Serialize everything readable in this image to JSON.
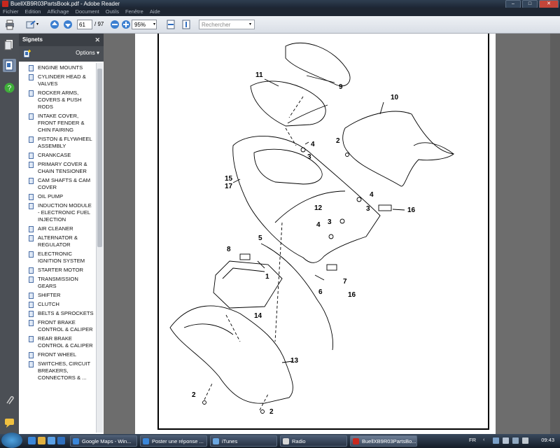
{
  "window": {
    "title": "BuellXB9R03PartsBook.pdf - Adobe Reader",
    "min": "–",
    "max": "□",
    "close": "✕"
  },
  "menu": [
    "Fichier",
    "Edition",
    "Affichage",
    "Document",
    "Outils",
    "Fenêtre",
    "Aide"
  ],
  "toolbar": {
    "page_value": "61",
    "page_total": "/ 97",
    "zoom": "95%",
    "search_placeholder": "Rechercher"
  },
  "bookmarks": {
    "header": "Signets",
    "options_label": "Options",
    "items": [
      "ENGINE MOUNTS",
      "CYLINDER HEAD & VALVES",
      "ROCKER ARMS, COVERS & PUSH RODS",
      "INTAKE COVER, FRONT FENDER & CHIN FAIRING",
      "PISTON & FLYWHEEL ASSEMBLY",
      "CRANKCASE",
      "PRIMARY COVER & CHAIN TENSIONER",
      "CAM SHAFTS & CAM COVER",
      "OIL PUMP",
      "INDUCTION MODULE - ELECTRONIC FUEL INJECTION",
      "AIR CLEANER",
      "ALTERNATOR & REGULATOR",
      "ELECTRONIC IGNITION SYSTEM",
      "STARTER MOTOR",
      "TRANSMISSION GEARS",
      "SHIFTER",
      "CLUTCH",
      "BELTS & SPROCKETS",
      "FRONT BRAKE CONTROL & CALIPER",
      "REAR BRAKE CONTROL & CALIPER",
      "FRONT WHEEL",
      "SWITCHES, CIRCUIT BREAKERS, CONNECTORS & ..."
    ]
  },
  "diagram": {
    "callouts": [
      "9",
      "11",
      "10",
      "2",
      "4",
      "3",
      "15",
      "17",
      "4",
      "16",
      "12",
      "3",
      "4",
      "3",
      "5",
      "8",
      "1",
      "6",
      "7",
      "16",
      "14",
      "13",
      "2",
      "2"
    ]
  },
  "taskbar": {
    "tasks": [
      "Google Maps - Win...",
      "Poster une réponse ...",
      "iTunes",
      "Radio",
      "BuellXB9R03PartsBo..."
    ],
    "lang": "FR",
    "clock": "09:43"
  }
}
